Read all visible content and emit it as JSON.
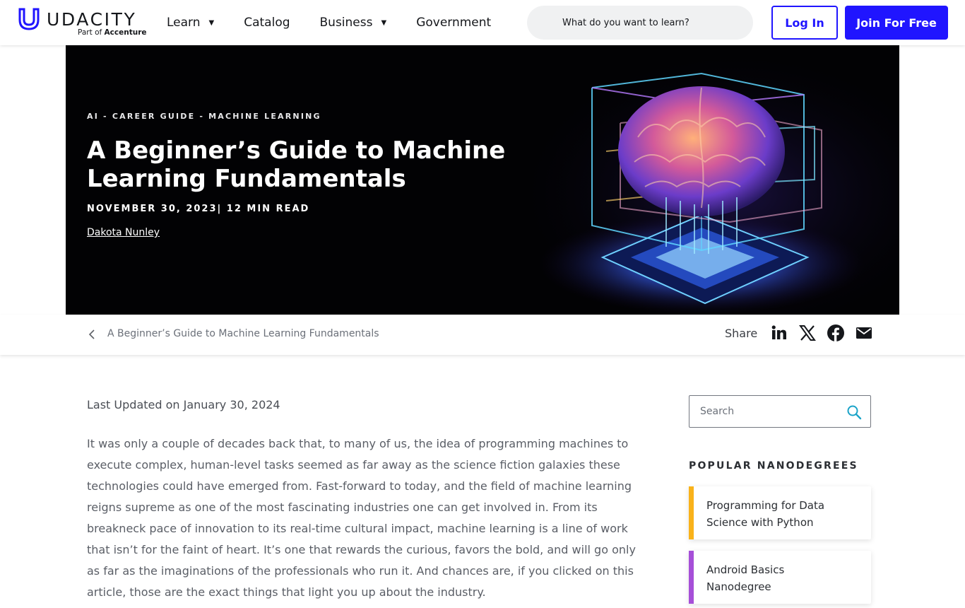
{
  "header": {
    "brand": "UDACITY",
    "brand_sub_prefix": "Part of",
    "brand_sub_name": "Accenture",
    "nav": [
      {
        "label": "Learn",
        "has_caret": true
      },
      {
        "label": "Catalog",
        "has_caret": false
      },
      {
        "label": "Business",
        "has_caret": true
      },
      {
        "label": "Government",
        "has_caret": false
      }
    ],
    "caret_glyph": "▼",
    "search_placeholder": "What do you want to learn?",
    "login_label": "Log In",
    "join_label": "Join For Free",
    "accent_color": "#2015ff"
  },
  "hero": {
    "categories": "AI - CAREER GUIDE - MACHINE LEARNING",
    "title": "A Beginner’s Guide to Machine Learning Fundamentals",
    "date_read": "NOVEMBER 30, 2023| 12 MIN READ",
    "author": "Dakota Nunley",
    "image_icon": "glowing-brain-illustration"
  },
  "breadcrumb": {
    "back_icon": "chevron-left-icon",
    "text": "A Beginner’s Guide to Machine Learning Fundamentals",
    "share_label": "Share",
    "share_icons": [
      "linkedin-icon",
      "x-icon",
      "facebook-icon",
      "email-icon"
    ]
  },
  "article": {
    "updated": "Last Updated on January 30, 2024",
    "paragraph": "It was only a couple of decades back that, to many of us, the idea of programming machines to execute complex, human-level tasks seemed as far away as the science fiction galaxies these technologies could have emerged from. Fast-forward to today, and the field of machine learning reigns supreme as one of the most fascinating industries one can get involved in. From its breakneck pace of innovation to its real-time cultural impact, machine learning is a line of work that isn’t for the faint of heart. It’s one that rewards the curious, favors the bold, and will go only as far as the imaginations of the professionals who run it. And chances are, if you clicked on this article, those are the exact things that light you up about the industry."
  },
  "sidebar": {
    "search_placeholder": "Search",
    "search_icon_color": "#1aa3c8",
    "popular_heading": "POPULAR NANODEGREES",
    "nanodegrees": [
      {
        "label": "Programming for Data Science with Python",
        "stripe_color": "#f9b21a"
      },
      {
        "label": "Android Basics Nanodegree",
        "stripe_color": "#a64fd8"
      }
    ]
  }
}
